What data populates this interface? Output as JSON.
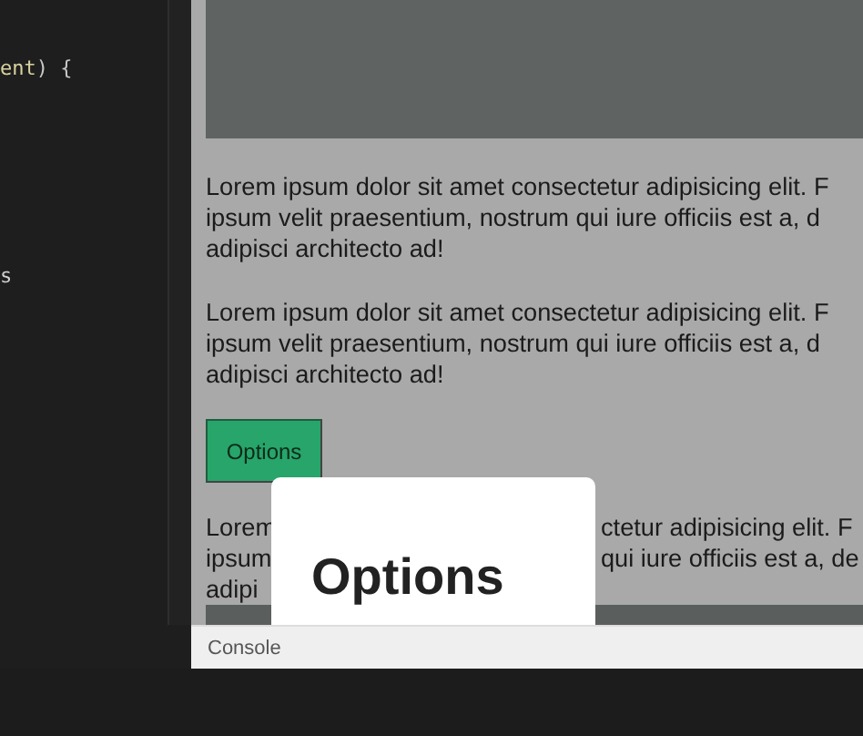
{
  "editor": {
    "lines": [
      {
        "tokens": [
          {
            "text": "ent",
            "kind": "identifier"
          },
          {
            "text": ") {",
            "kind": "punctuation"
          }
        ]
      },
      {
        "tokens": [
          {
            "text": "s",
            "kind": "plain"
          }
        ]
      }
    ]
  },
  "preview": {
    "paragraphs": [
      {
        "lines": [
          "Lorem ipsum dolor sit amet consectetur adipisicing elit. F",
          "ipsum velit praesentium, nostrum qui iure officiis est a, d",
          "adipisci architecto ad!"
        ]
      },
      {
        "lines": [
          "Lorem ipsum dolor sit amet consectetur adipisicing elit. F",
          "ipsum velit praesentium, nostrum qui iure officiis est a, d",
          "adipisci architecto ad!"
        ]
      }
    ],
    "button": "Options",
    "covered_paragraph": {
      "lines": [
        {
          "left": "Lorem",
          "right": "ctetur adipisicing elit. F"
        },
        {
          "left": "ipsum",
          "right": "qui iure officiis est a, de"
        },
        {
          "left": "adipi"
        }
      ]
    },
    "modal": {
      "title": "Options"
    }
  },
  "console": {
    "label": "Console"
  }
}
